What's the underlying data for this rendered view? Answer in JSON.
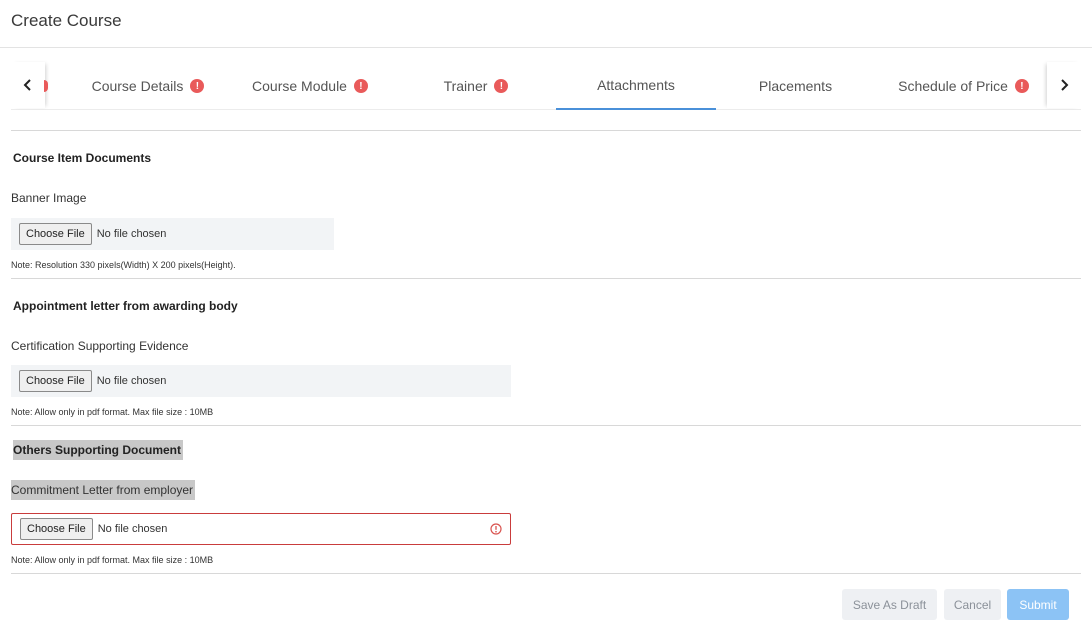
{
  "page": {
    "title": "Create Course"
  },
  "tabs": [
    {
      "label": "Course Details",
      "error": "!"
    },
    {
      "label": "Course Module",
      "error": "!"
    },
    {
      "label": "Trainer",
      "error": "!"
    },
    {
      "label": "Attachments"
    },
    {
      "label": "Placements"
    },
    {
      "label": "Schedule of Price",
      "error": "!"
    }
  ],
  "active_tab": "Attachments",
  "sections": {
    "course_item": {
      "title": "Course Item Documents",
      "field_label": "Banner Image",
      "button": "Choose File",
      "file_status": "No file chosen",
      "note": "Note: Resolution 330 pixels(Width) X 200 pixels(Height)."
    },
    "appointment": {
      "title": "Appointment letter from awarding body",
      "field_label": "Certification Supporting Evidence",
      "button": "Choose File",
      "file_status": "No file chosen",
      "note": "Note: Allow only in pdf format. Max file size : 10MB"
    },
    "others": {
      "title": "Others Supporting Document",
      "field_label": "Commitment Letter from employer",
      "button": "Choose File",
      "file_status": "No file chosen",
      "note": "Note: Allow only in pdf format. Max file size : 10MB"
    }
  },
  "footer": {
    "save_draft": "Save As Draft",
    "cancel": "Cancel",
    "submit": "Submit"
  },
  "colors": {
    "accent": "#4a90d9",
    "error": "#e95a5a",
    "submit_bg": "#8cc3f5"
  }
}
